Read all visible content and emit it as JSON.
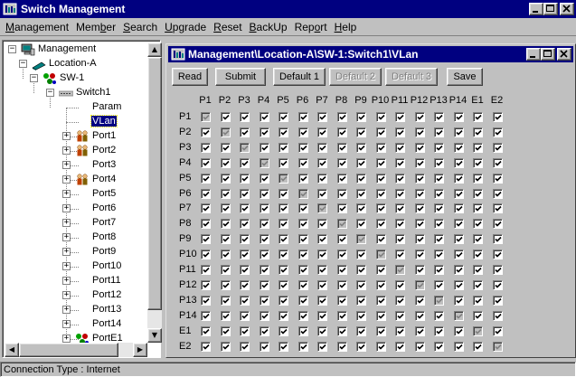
{
  "app": {
    "title": "Switch Management",
    "window_buttons": [
      "_",
      "□",
      "×"
    ]
  },
  "menu": [
    {
      "label": "Management",
      "key": "M"
    },
    {
      "label": "Member",
      "key": "b"
    },
    {
      "label": "Search",
      "key": "S"
    },
    {
      "label": "Upgrade",
      "key": "U"
    },
    {
      "label": "Reset",
      "key": "R"
    },
    {
      "label": "BackUp",
      "key": "B"
    },
    {
      "label": "Report",
      "key": "o"
    },
    {
      "label": "Help",
      "key": "H"
    }
  ],
  "tree": {
    "nodes": [
      {
        "label": "Management",
        "level": 0,
        "expander": "−",
        "icon": "computer-icon"
      },
      {
        "label": "Location-A",
        "level": 1,
        "expander": "−",
        "icon": "location-icon"
      },
      {
        "label": "SW-1",
        "level": 2,
        "expander": "−",
        "icon": "network-icon"
      },
      {
        "label": "Switch1",
        "level": 3,
        "expander": "−",
        "icon": "switch-icon"
      },
      {
        "label": "Param",
        "level": 4,
        "expander": "",
        "icon": ""
      },
      {
        "label": "VLan",
        "level": 4,
        "expander": "",
        "icon": "",
        "selected": true
      },
      {
        "label": "Port1",
        "level": 4,
        "expander": "+",
        "icon": "port-user-icon"
      },
      {
        "label": "Port2",
        "level": 4,
        "expander": "+",
        "icon": "port-user-icon"
      },
      {
        "label": "Port3",
        "level": 4,
        "expander": "+",
        "icon": ""
      },
      {
        "label": "Port4",
        "level": 4,
        "expander": "+",
        "icon": "port-user-icon"
      },
      {
        "label": "Port5",
        "level": 4,
        "expander": "+",
        "icon": ""
      },
      {
        "label": "Port6",
        "level": 4,
        "expander": "+",
        "icon": ""
      },
      {
        "label": "Port7",
        "level": 4,
        "expander": "+",
        "icon": ""
      },
      {
        "label": "Port8",
        "level": 4,
        "expander": "+",
        "icon": ""
      },
      {
        "label": "Port9",
        "level": 4,
        "expander": "+",
        "icon": ""
      },
      {
        "label": "Port10",
        "level": 4,
        "expander": "+",
        "icon": ""
      },
      {
        "label": "Port11",
        "level": 4,
        "expander": "+",
        "icon": ""
      },
      {
        "label": "Port12",
        "level": 4,
        "expander": "+",
        "icon": ""
      },
      {
        "label": "Port13",
        "level": 4,
        "expander": "+",
        "icon": ""
      },
      {
        "label": "Port14",
        "level": 4,
        "expander": "+",
        "icon": ""
      },
      {
        "label": "PortE1",
        "level": 4,
        "expander": "+",
        "icon": "network-icon"
      }
    ]
  },
  "vlan_window": {
    "title": "Management\\Location-A\\SW-1:Switch1\\VLan",
    "buttons": [
      {
        "label": "Read",
        "enabled": true
      },
      {
        "label": "Submit",
        "enabled": true
      },
      {
        "label": "Default 1",
        "enabled": true
      },
      {
        "label": "Default 2",
        "enabled": false
      },
      {
        "label": "Default 3",
        "enabled": false
      },
      {
        "label": "Save",
        "enabled": true
      }
    ],
    "ports": [
      "P1",
      "P2",
      "P3",
      "P4",
      "P5",
      "P6",
      "P7",
      "P8",
      "P9",
      "P10",
      "P11",
      "P12",
      "P13",
      "P14",
      "E1",
      "E2"
    ],
    "checked": true,
    "self_disabled": true
  },
  "status": {
    "text": "Connection Type : Internet"
  }
}
